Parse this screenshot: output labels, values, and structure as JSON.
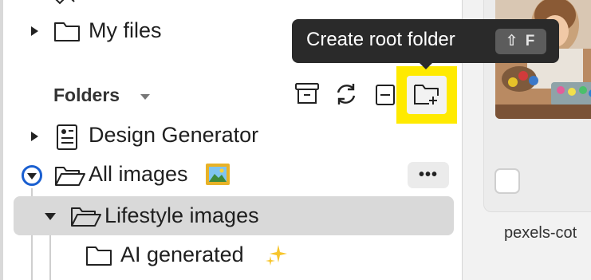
{
  "sidebar": {
    "my_files": "My files",
    "folders_title": "Folders",
    "toolbar": {
      "archive_icon": "archive-icon",
      "sync_icon": "sync-icon",
      "collapse_icon": "collapse-icon",
      "create_root_folder_icon": "folder-plus-icon"
    },
    "tree": {
      "design_generator": "Design Generator",
      "all_images": "All images",
      "all_images_emoji": "framed-picture",
      "lifestyle_images": "Lifestyle images",
      "ai_generated": "AI generated",
      "ai_generated_emoji": "sparkles"
    },
    "more_label": "•••"
  },
  "tooltip": {
    "label": "Create root folder",
    "shortcut": "⇧ F"
  },
  "preview": {
    "filename": "pexels-cot"
  },
  "colors": {
    "highlight": "#ffea00",
    "focus_ring": "#1a5fd0",
    "selected_row": "#d9d9d9",
    "tooltip_bg": "#2a2a2a"
  }
}
